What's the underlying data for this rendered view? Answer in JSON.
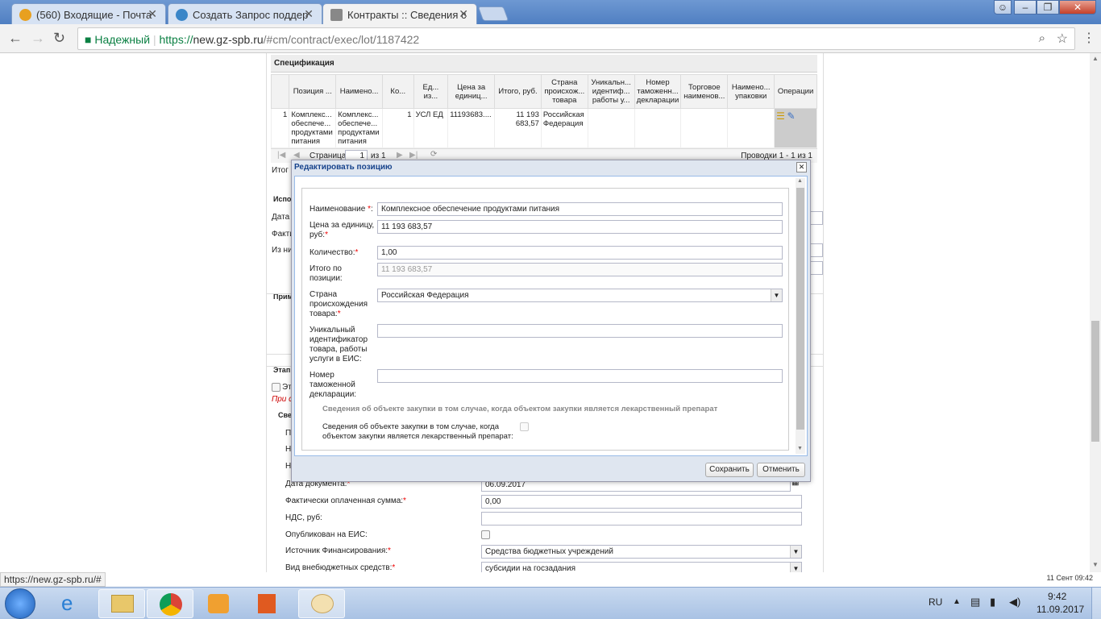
{
  "browser": {
    "tabs": [
      {
        "title": "(560) Входящие - Почта",
        "color": "#e8a020"
      },
      {
        "title": "Создать Запрос поддер",
        "color": "#3a86c8"
      },
      {
        "title": "Контракты :: Сведения с",
        "color": "#888888"
      }
    ],
    "secure_label": "Надежный",
    "url_prefix": "https://",
    "url_host": "new.gz-spb.ru",
    "url_path": "/#cm/contract/exec/lot/1187422"
  },
  "spec": {
    "header": "Спецификация",
    "columns": [
      "",
      "Позиция ...",
      "Наимено...",
      "Ко...",
      "Ед... из...",
      "Цена за единиц...",
      "Итого, руб.",
      "Страна происхож... товара",
      "Уникальн... идентиф... работы у...",
      "Номер таможенн... декларации",
      "Торговое наименов...",
      "Наимено... упаковки",
      "Операции"
    ],
    "row": [
      "1",
      "Комплекс... обеспече... продуктами питания",
      "Комплекс... обеспече... продуктами питания",
      "1",
      "УСЛ ЕД",
      "11193683....",
      "11 193 683,57",
      "Российская Федерация",
      "",
      "",
      "",
      "",
      ""
    ],
    "pager_page_label": "Страница",
    "pager_page": "1",
    "pager_of": "из 1",
    "pager_info": "Проводки 1 - 1 из 1",
    "itogo": "Итог"
  },
  "bg_cut_labels": [
    "Испол",
    "Дата з",
    "Факти",
    "Из ни",
    "Прим",
    "Этап",
    "Эта",
    "При с",
    "Свед",
    "Пл",
    "На",
    "Н"
  ],
  "bg_form": {
    "date_label": "Дата документа:",
    "date_value": "06.09.2017",
    "paid_label": "Фактически оплаченная сумма:",
    "paid_value": "0,00",
    "nds_label": "НДС, руб:",
    "nds_value": "",
    "published_label": "Опубликован на ЕИС:",
    "source_label": "Источник Финансирования:",
    "source_value": "Средства бюджетных учреждений",
    "extra_label": "Вид внебюджетных средств:",
    "extra_value": "субсидии на госзадания"
  },
  "modal": {
    "title": "Редактировать позицию",
    "name_label": "Наименование",
    "name_value": "Комплексное обеспечение продуктами питания",
    "price_label_1": "Цена за единицу,",
    "price_label_2": "руб:",
    "price_value": "11 193 683,57",
    "qty_label": "Количество:",
    "qty_value": "1,00",
    "total_label_1": "Итого по",
    "total_label_2": "позиции:",
    "total_value": "11 193 683,57",
    "country_label_1": "Страна",
    "country_label_2": "происхождения",
    "country_label_3": "товара:",
    "country_value": "Российская Федерация",
    "uid_label_1": "Уникальный",
    "uid_label_2": "идентификатор",
    "uid_label_3": "товара, работы",
    "uid_label_4": "услуги в ЕИС:",
    "uid_value": "",
    "customs_label_1": "Номер",
    "customs_label_2": "таможенной",
    "customs_label_3": "декларации:",
    "customs_value": "",
    "drug_section": "Сведения об объекте закупки в том случае, когда объектом закупки является лекарственный препарат",
    "drug_label_1": "Сведения об объекте закупки в том случае, когда",
    "drug_label_2": "объектом закупки является лекарственный препарат:",
    "save": "Сохранить",
    "cancel": "Отменить"
  },
  "status_url": "https://new.gz-spb.ru/#",
  "status_right": "11 Сент 09:42",
  "taskbar": {
    "lang": "RU",
    "time": "9:42",
    "date": "11.09.2017"
  }
}
